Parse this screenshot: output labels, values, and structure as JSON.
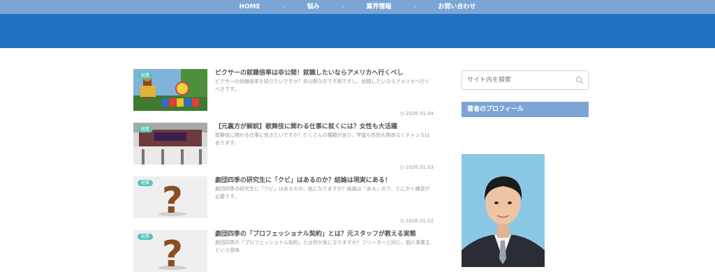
{
  "nav": {
    "items": [
      "HOME",
      "悩み",
      "業界情報",
      "お問い合わせ"
    ],
    "separator": "-"
  },
  "colors": {
    "nav_bg": "#7ca5d6",
    "hero_bg": "#1f72c0",
    "badge": "#5bc3b3",
    "widget_heading": "#7ca5d6"
  },
  "posts": [
    {
      "category": "就業",
      "title": "ピクサーの就職倍率は非公開！就職したいならアメリカへ行くべし",
      "excerpt": "ピクサーの就職倍率を知りたいですか？非公開なので不明ですし、就職したいならアメリカへ行くべきです。",
      "date": "2026.01.04",
      "thumbnail": "toy-story-land-image"
    },
    {
      "category": "就業",
      "title": "【元裏方が解説】歌舞伎に関わる仕事に就くには？女性も大活躍",
      "excerpt": "歌舞伎に関わる仕事に就きたいですか？たくさんの種類があり、学歴も性別も関係なくチャンスはあります。",
      "date": "2026.01.03",
      "thumbnail": "theater-facade-image"
    },
    {
      "category": "就業",
      "title": "劇団四季の研究生に「クビ」はあるのか？結論は現実にある！",
      "excerpt": "劇団四季の研究生に「クビ」はあるのか、気になりますか？結論は「ある」ので、とにかく練習が必要です。",
      "date": "2026.01.02",
      "thumbnail": "question-mark-image"
    },
    {
      "category": "就業",
      "title": "劇団四季の「プロフェッショナル契約」とは？元スタッフが教える実態",
      "excerpt": "劇団四季の「プロフェッショナル契約」とは何か気になりますか？フリーターと同じ、個人事業主という意味",
      "date": "",
      "thumbnail": "question-mark-image"
    }
  ],
  "sidebar": {
    "search_placeholder": "サイト内を検索",
    "profile_heading": "著者のプロフィール"
  }
}
